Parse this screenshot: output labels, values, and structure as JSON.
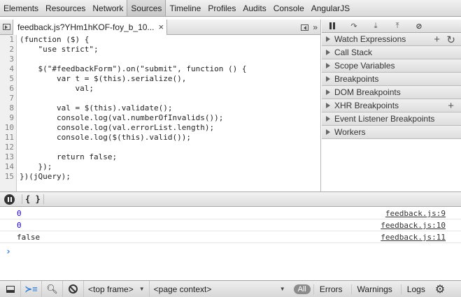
{
  "tabs": [
    "Elements",
    "Resources",
    "Network",
    "Sources",
    "Timeline",
    "Profiles",
    "Audits",
    "Console",
    "AngularJS"
  ],
  "active_tab": "Sources",
  "file_tab": {
    "name": "feedback.js?YHm1hKOF-foy_b_10...",
    "close": "×"
  },
  "code_lines": [
    {
      "n": "1",
      "t": "(function ($) {"
    },
    {
      "n": "2",
      "t": "    \"use strict\";"
    },
    {
      "n": "3",
      "t": ""
    },
    {
      "n": "4",
      "t": "    $(\"#feedbackForm\").on(\"submit\", function () {"
    },
    {
      "n": "5",
      "t": "        var t = $(this).serialize(),"
    },
    {
      "n": "6",
      "t": "            val;"
    },
    {
      "n": "7",
      "t": ""
    },
    {
      "n": "8",
      "t": "        val = $(this).validate();"
    },
    {
      "n": "9",
      "t": "        console.log(val.numberOfInvalids());"
    },
    {
      "n": "10",
      "t": "        console.log(val.errorList.length);"
    },
    {
      "n": "11",
      "t": "        console.log($(this).valid());"
    },
    {
      "n": "12",
      "t": ""
    },
    {
      "n": "13",
      "t": "        return false;"
    },
    {
      "n": "14",
      "t": "    });"
    },
    {
      "n": "15",
      "t": "})(jQuery);"
    }
  ],
  "sidebar": {
    "panes": [
      {
        "label": "Watch Expressions",
        "actions": [
          "+",
          "↻"
        ]
      },
      {
        "label": "Call Stack"
      },
      {
        "label": "Scope Variables"
      },
      {
        "label": "Breakpoints"
      },
      {
        "label": "DOM Breakpoints"
      },
      {
        "label": "XHR Breakpoints",
        "actions": [
          "+"
        ]
      },
      {
        "label": "Event Listener Breakpoints"
      },
      {
        "label": "Workers"
      }
    ]
  },
  "console": {
    "pretty_print": "{ }",
    "messages": [
      {
        "value": "0",
        "source": "feedback.js:9",
        "type": "number"
      },
      {
        "value": "0",
        "source": "feedback.js:10",
        "type": "number"
      },
      {
        "value": "false",
        "source": "feedback.js:11",
        "type": "boolean"
      }
    ],
    "prompt": "›"
  },
  "bottombar": {
    "frame_select": "<top frame>",
    "context_select": "<page context>",
    "filter_all": "All",
    "filters": [
      "Errors",
      "Warnings",
      "Logs"
    ]
  },
  "icons": [
    "dock-icon",
    "console-icon",
    "search-icon",
    "no-entry-icon",
    "gear-icon",
    "pause-icon",
    "step-over-icon",
    "step-into-icon",
    "step-out-icon",
    "deactivate-breakpoints-icon"
  ]
}
